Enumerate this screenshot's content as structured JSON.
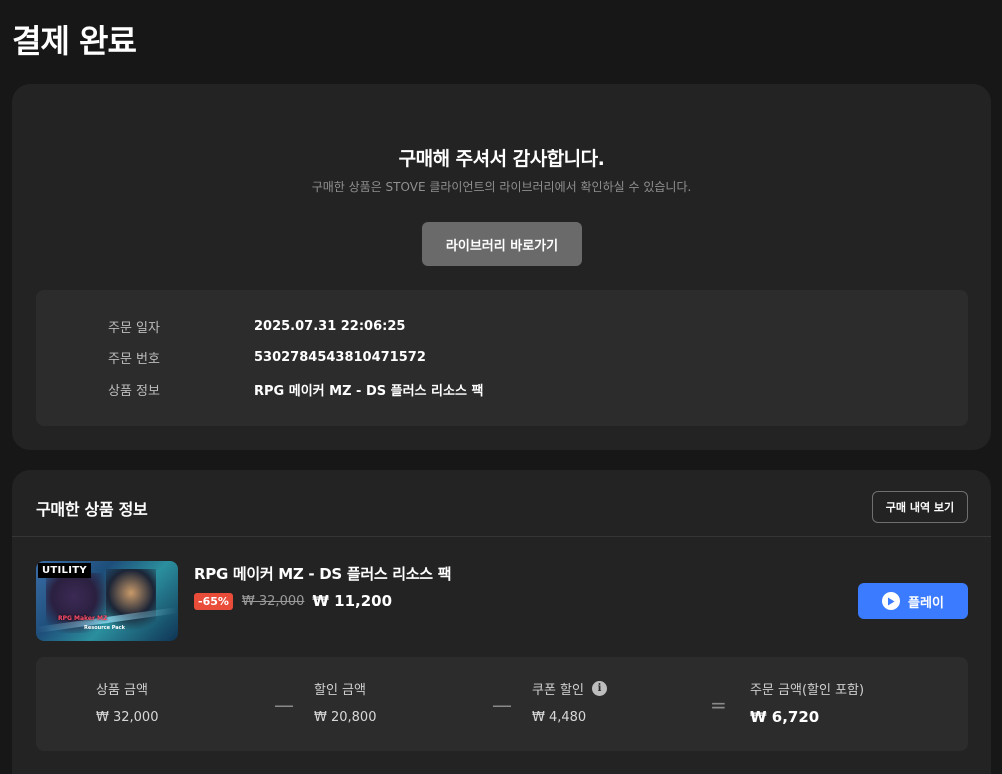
{
  "page": {
    "title": "결제 완료"
  },
  "thanks": {
    "heading": "구매해 주셔서 감사합니다.",
    "subtitle": "구매한 상품은 STOVE 클라이언트의 라이브러리에서 확인하실 수 있습니다.",
    "library_button": "라이브러리 바로가기"
  },
  "order": {
    "date_label": "주문 일자",
    "date_value": "2025.07.31 22:06:25",
    "number_label": "주문 번호",
    "number_value": "5302784543810471572",
    "product_label": "상품 정보",
    "product_value": "RPG 메이커 MZ - DS 플러스 리소스 팩"
  },
  "purchased": {
    "title": "구매한 상품 정보",
    "history_button": "구매 내역 보기",
    "item": {
      "tag": "UTILITY",
      "thumb_logo": "RPG Maker MZ",
      "thumb_logo_sub": "Resource Pack",
      "name": "RPG 메이커 MZ - DS 플러스 리소스 팩",
      "discount": "-65%",
      "original_price": "₩ 32,000",
      "sale_price": "₩ 11,200",
      "play_button": "플레이"
    }
  },
  "summary": {
    "product_amount_label": "상품 금액",
    "product_amount": "₩ 32,000",
    "discount_amount_label": "할인 금액",
    "discount_amount": "₩ 20,800",
    "coupon_label": "쿠폰 할인",
    "coupon_amount": "₩ 4,480",
    "total_label": "주문 금액(할인 포함)",
    "total_amount": "₩ 6,720",
    "minus_symbol": "—",
    "equals_symbol": "="
  },
  "colors": {
    "background": "#171717",
    "card": "#232323",
    "accent_blue": "#3b7bff",
    "discount_red": "#ea4c3a"
  },
  "icons": {
    "play": "play-circle-icon",
    "info": "info-icon"
  }
}
